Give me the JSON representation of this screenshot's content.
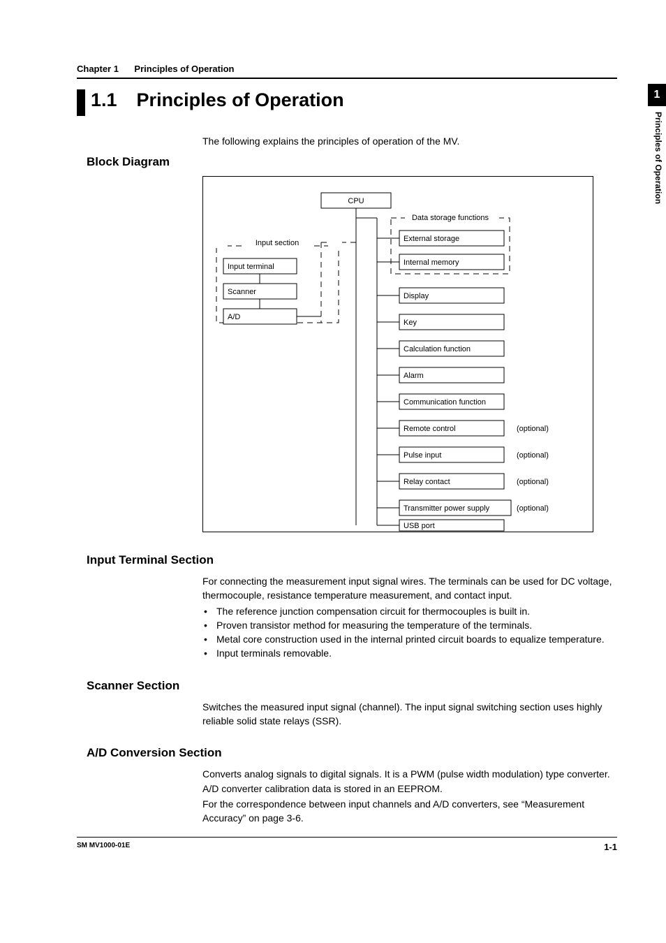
{
  "chapter_label": "Chapter 1",
  "chapter_title": "Principles of Operation",
  "section_number": "1.1",
  "section_title": "Principles of Operation",
  "intro": "The following explains the principles of operation of the MV.",
  "block_diagram_heading": "Block Diagram",
  "diagram": {
    "cpu": "CPU",
    "input_section_label": "Input section",
    "input_terminal": "Input terminal",
    "scanner": "Scanner",
    "ad": "A/D",
    "data_storage_label": "Data storage functions",
    "external_storage": "External storage",
    "internal_memory": "Internal memory",
    "display": "Display",
    "key": "Key",
    "calculation": "Calculation function",
    "alarm": "Alarm",
    "communication": "Communication function",
    "remote_control": "Remote control",
    "pulse_input": "Pulse input",
    "relay_contact": "Relay contact",
    "transmitter": "Transmitter power supply",
    "usb": "USB port",
    "optional": "(optional)"
  },
  "sections": {
    "input_terminal": {
      "heading": "Input Terminal Section",
      "p1": "For connecting the measurement input signal wires. The terminals can be used for DC voltage, thermocouple, resistance temperature measurement, and contact input.",
      "b1": "The reference junction compensation circuit for thermocouples is built in.",
      "b2": "Proven transistor method for measuring the temperature of the terminals.",
      "b3": "Metal core construction used in the internal printed circuit boards to equalize temperature.",
      "b4": "Input terminals removable."
    },
    "scanner": {
      "heading": "Scanner Section",
      "p1": "Switches the measured input signal (channel). The input signal switching section uses highly reliable solid state relays (SSR)."
    },
    "ad": {
      "heading": "A/D Conversion Section",
      "p1": "Converts analog signals to digital signals. It is a PWM (pulse width modulation) type converter. A/D converter calibration data is stored in an EEPROM.",
      "p2": "For the correspondence between input channels and A/D converters, see “Measurement Accuracy” on page 3-6."
    }
  },
  "tab_number": "1",
  "tab_text": "Principles of Operation",
  "footer_left": "SM MV1000-01E",
  "footer_right": "1-1"
}
